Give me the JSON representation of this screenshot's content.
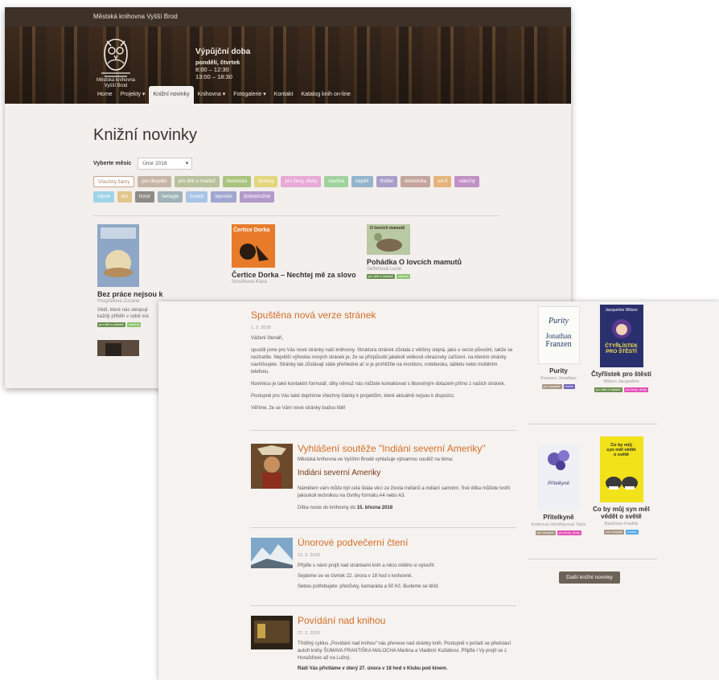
{
  "shot1": {
    "site_name": "Městská knihovna Vyšší Brod",
    "logo_text": [
      "Městská knihovna",
      "Vyšší Brod"
    ],
    "hours": {
      "title": "Výpůjční doba",
      "days": "pondělí, čtvrtek",
      "slot1": "8:00 – 12:30",
      "slot2": "13:00 – 18:30"
    },
    "nav": [
      "Home",
      "Projekty ▾",
      "Knižní novinky",
      "Knihovna ▾",
      "Fotogalerie ▾",
      "Kontakt",
      "Katalog knih on-line"
    ],
    "nav_active_index": 2,
    "page_title": "Knižní novinky",
    "month_label": "Vyberte měsíc",
    "month_value": "Únor 2018",
    "tags": [
      {
        "label": "Všechny žánry",
        "color": "#ffffff"
      },
      {
        "label": "pro dospělé",
        "color": "#c6b5a6"
      },
      {
        "label": "pro děti a mládež",
        "color": "#b7c29c"
      },
      {
        "label": "historická",
        "color": "#a9c47c"
      },
      {
        "label": "fantasy",
        "color": "#e3d67e"
      },
      {
        "label": "pro ženy, dívky",
        "color": "#e8a9d6"
      },
      {
        "label": "naučná",
        "color": "#9fd39e"
      },
      {
        "label": "napětí",
        "color": "#93b4cd"
      },
      {
        "label": "thriller",
        "color": "#a8a0c8"
      },
      {
        "label": "detektivka",
        "color": "#c4a49b"
      },
      {
        "label": "sci-fi",
        "color": "#e5b47a"
      },
      {
        "label": "válečný",
        "color": "#c190c6"
      },
      {
        "label": "vtipné",
        "color": "#9ed4e8"
      },
      {
        "label": "bio",
        "color": "#e0c68a"
      },
      {
        "label": "horor",
        "color": "#8e8a86"
      },
      {
        "label": "fantagie",
        "color": "#9fb2b5"
      },
      {
        "label": "humor",
        "color": "#a8c4e6"
      },
      {
        "label": "leporelo",
        "color": "#9fa6cf"
      },
      {
        "label": "dobrodružné",
        "color": "#b29acb"
      }
    ],
    "books": [
      {
        "title": "Bez práce nejsou k",
        "author": "Pospíšilová Zuzana",
        "desc": [
          "Vědí, které nás oklopují",
          "každý příběh v sobě má"
        ],
        "tags": [
          "pro děti a mládež",
          "naučná"
        ]
      },
      {
        "title": "Čertice Dorka – Nechtej mě za slovo",
        "author": "Smolíková Klára",
        "cover_text": "Čertice Dorka"
      },
      {
        "title": "Pohádka O lovcích mamutů",
        "author": "Seifertová Lucie",
        "cover_text": "O lovcích mamutů",
        "tags": [
          "pro děti a mládež",
          "naučná"
        ]
      }
    ]
  },
  "shot2": {
    "news": [
      {
        "title": "Spuštěna nová verze stránek",
        "date": "1. 2. 2018",
        "paragraphs": [
          "Vážení čtenáři,",
          "spustili jsme pro Vás nové stránky naší knihovny. Struktura stránek zůstala z většiny stejná, jako u verze původní, takže se neztratíte. Největší výhodou nových stránek je, že se přizpůsobí jakékoli velikosti obrazovky zařízení, na kterém stránky navštívujete. Stránky tak zůstávají stále přehledné ať si je prohlížíte na monitoru, notebooku, tabletu nebo mobilním telefonu.",
          "Novinkou je také kontaktní formulář, díky němuž nás můžete kontaktovat s libovolným dotazem přímo z našich stránek.",
          "Postupně pro Vás také doplníme všechny články k projektům, které aktuálně nejsou k dispozici.",
          "Věříme, že se Vám nové stránky budou líbit!"
        ]
      },
      {
        "title": "Vyhlášení soutěže \"Indiáni severní Ameriky\"",
        "intro": "Městská knihovna ve Vyšším Brodě vyhlašuje výtvarnou soutěž na téma:",
        "subtitle": "Indiáni severní Ameriky",
        "paragraphs": [
          "Námětem vám může být celá škála věcí ze života Indiánů a indiání samotní. Své dílka můžete tvořit jakoukoli technikou na čtvrtky formátu A4 nebo A3.",
          "Dílka noste do knihovny do"
        ],
        "deadline": "15. března 2018"
      },
      {
        "title": "Únorové podvečerní čtení",
        "date": "13. 2. 2018",
        "paragraphs": [
          "Přijďte s námi projít nad stránkami knih a něco milého si vytvořit.",
          "Sejdeme se ve čtvrtek 22. února v 18 hod v knihovně.",
          "Sebou potřebujete: přezůvky, kamaráda a 50 Kč. Budeme se těšit."
        ]
      },
      {
        "title": "Povídání nad knihou",
        "date": "27. 2. 2018",
        "paragraphs": [
          "Třídílný cyklus „Povídání nad knihou“ nás přenese nad stránky knih. Postupně v pořadí se představí autoři knihy ŠUMAVA FRANTIŠKA MALOCHA Martina a Vladimír Koželkovi. Přijďte i Vy projít se z Horažďovic až na Lužný."
        ],
        "footer": "Rádi Vás přivítáme v úterý 27. února v 18 hod v Klubu pod kinem."
      }
    ],
    "side_books": [
      {
        "title": "Purity",
        "author": "Franzen Jonathan",
        "cover_lines": [
          "Purity",
          "Jonathan",
          "Franzen"
        ],
        "tags": [
          "pro dospělé",
          "thriller"
        ]
      },
      {
        "title": "Čtyřlístek pro štěstí",
        "author": "Wilson Jacqueline",
        "cover_lines": [
          "Jacqueline Wilson",
          "ČTYŘLÍSTEK",
          "PRO ŠTĚSTÍ"
        ],
        "tags": [
          "pro děti a mládež",
          "pro ženy, dívky"
        ]
      },
      {
        "title": "Přítelkyně",
        "author": "Kotinová-Vondřejcová Táňa",
        "cover_lines": [
          "Přítelkyně"
        ],
        "tags": [
          "pro dospělé",
          "pro ženy, dívky"
        ]
      },
      {
        "title": "Co by můj syn měl vědět o světě",
        "author": "Backman Fredrik",
        "cover_lines": [
          "Co by můj",
          "syn měl vědět",
          "o světě"
        ],
        "tags": [
          "pro dospělé",
          "humor"
        ]
      }
    ],
    "more_button": "Další knižní novinky"
  }
}
